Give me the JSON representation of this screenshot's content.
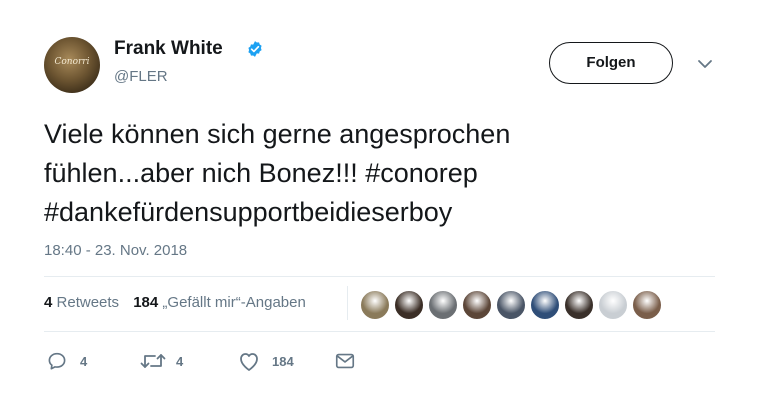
{
  "author": {
    "name": "Frank White",
    "handle": "@FLER",
    "avatar_text": "Conorri",
    "verified_icon": "verified-badge-icon"
  },
  "follow_label": "Folgen",
  "tweet": {
    "line1": "Viele können sich gerne angesprochen",
    "line2": "fühlen...aber nich Bonez!!! #conorep",
    "line3": "#dankefürdensupportbeidieserboy",
    "timestamp": "18:40 - 23. Nov. 2018"
  },
  "stats": {
    "retweets_count": "4",
    "retweets_label": "Retweets",
    "likes_count": "184",
    "likes_label": "„Gefällt mir“-Angaben"
  },
  "likers": [
    {
      "name": "liker-1",
      "color": "#8a7a5a"
    },
    {
      "name": "liker-2",
      "color": "#3b2e26"
    },
    {
      "name": "liker-3",
      "color": "#6b6f73"
    },
    {
      "name": "liker-4",
      "color": "#5c4638"
    },
    {
      "name": "liker-5",
      "color": "#4a5566"
    },
    {
      "name": "liker-6",
      "color": "#2f4e78"
    },
    {
      "name": "liker-7",
      "color": "#3a302a"
    },
    {
      "name": "liker-8",
      "color": "#c9ced3"
    },
    {
      "name": "liker-9",
      "color": "#7a5e4a"
    }
  ],
  "actions": {
    "reply_count": "4",
    "retweet_count": "4",
    "like_count": "184"
  },
  "colors": {
    "accent": "#1da1f2",
    "text": "#14171a",
    "muted": "#657786"
  }
}
